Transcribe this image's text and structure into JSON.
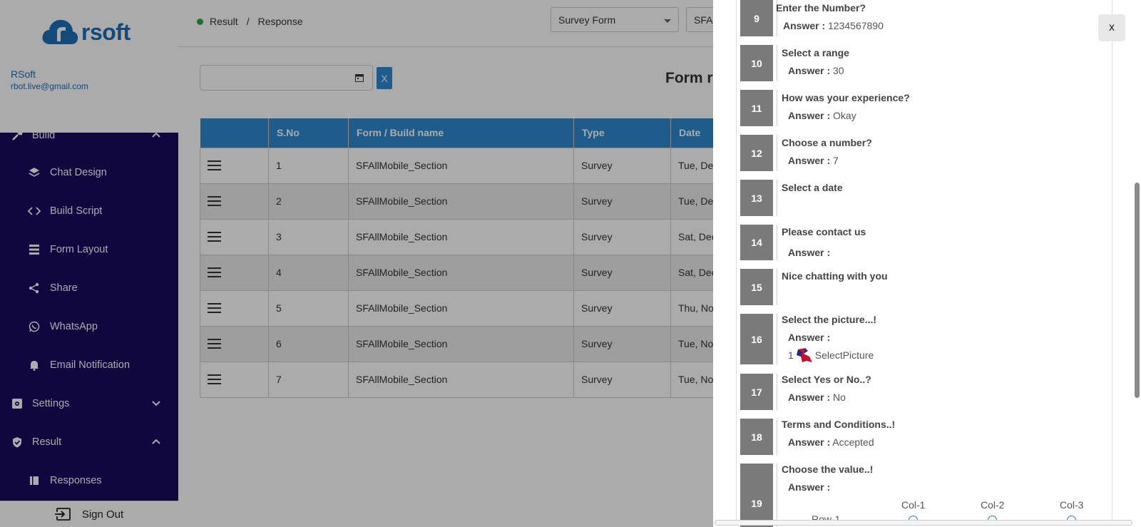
{
  "brand": {
    "name": "rsoft"
  },
  "user": {
    "name": "RSoft",
    "email": "rbot.live@gmail.com"
  },
  "sidebar": {
    "build": {
      "label": "Build"
    },
    "items": [
      {
        "label": "Chat Design",
        "icon": "layers-icon"
      },
      {
        "label": "Build Script",
        "icon": "code-icon"
      },
      {
        "label": "Form Layout",
        "icon": "list-icon"
      },
      {
        "label": "Share",
        "icon": "share-icon"
      },
      {
        "label": "WhatsApp",
        "icon": "whatsapp-icon"
      },
      {
        "label": "Email Notification",
        "icon": "bell-icon"
      }
    ],
    "settings": {
      "label": "Settings"
    },
    "result": {
      "label": "Result"
    },
    "responses": {
      "label": "Responses"
    },
    "signout": {
      "label": "Sign Out"
    }
  },
  "breadcrumb": {
    "first": "Result",
    "sep": "/",
    "second": "Response"
  },
  "filters": {
    "form_select": "Survey Form",
    "build_select": "SFA"
  },
  "date_clear_label": "X",
  "heading": "Form re",
  "table": {
    "headers": [
      "",
      "S.No",
      "Form / Build name",
      "Type",
      "Date"
    ],
    "rows": [
      {
        "sno": "1",
        "name": "SFAllMobile_Section",
        "type": "Survey",
        "date": "Tue, De"
      },
      {
        "sno": "2",
        "name": "SFAllMobile_Section",
        "type": "Survey",
        "date": "Tue, De"
      },
      {
        "sno": "3",
        "name": "SFAllMobile_Section",
        "type": "Survey",
        "date": "Sat, Dec"
      },
      {
        "sno": "4",
        "name": "SFAllMobile_Section",
        "type": "Survey",
        "date": "Sat, Dec"
      },
      {
        "sno": "5",
        "name": "SFAllMobile_Section",
        "type": "Survey",
        "date": "Thu, No"
      },
      {
        "sno": "6",
        "name": "SFAllMobile_Section",
        "type": "Survey",
        "date": "Tue, No"
      },
      {
        "sno": "7",
        "name": "SFAllMobile_Section",
        "type": "Survey",
        "date": "Tue, No"
      }
    ]
  },
  "panel": {
    "close_label": "x",
    "answer_label": "Answer :",
    "questions": [
      {
        "num": "9",
        "title": "Enter the Number?",
        "answer": "1234567890"
      },
      {
        "num": "10",
        "title": "Select a range",
        "answer": "30"
      },
      {
        "num": "11",
        "title": "How was your experience?",
        "answer": "Okay"
      },
      {
        "num": "12",
        "title": "Choose a number?",
        "answer": "7"
      },
      {
        "num": "13",
        "title": "Select a date"
      },
      {
        "num": "14",
        "title": "Please contact us",
        "answer": ""
      },
      {
        "num": "15",
        "title": "Nice chatting with you"
      },
      {
        "num": "16",
        "title": "Select the picture...!",
        "answer": "",
        "picture_index": "1",
        "picture_label": "SelectPicture"
      },
      {
        "num": "17",
        "title": "Select Yes or No..?",
        "answer": "No"
      },
      {
        "num": "18",
        "title": "Terms and Conditions..!",
        "answer": "Accepted"
      },
      {
        "num": "19",
        "title": "Choose the value..!",
        "answer": "",
        "columns": [
          "Col-1",
          "Col-2",
          "Col-3"
        ],
        "row_label": "Row-1"
      }
    ]
  }
}
